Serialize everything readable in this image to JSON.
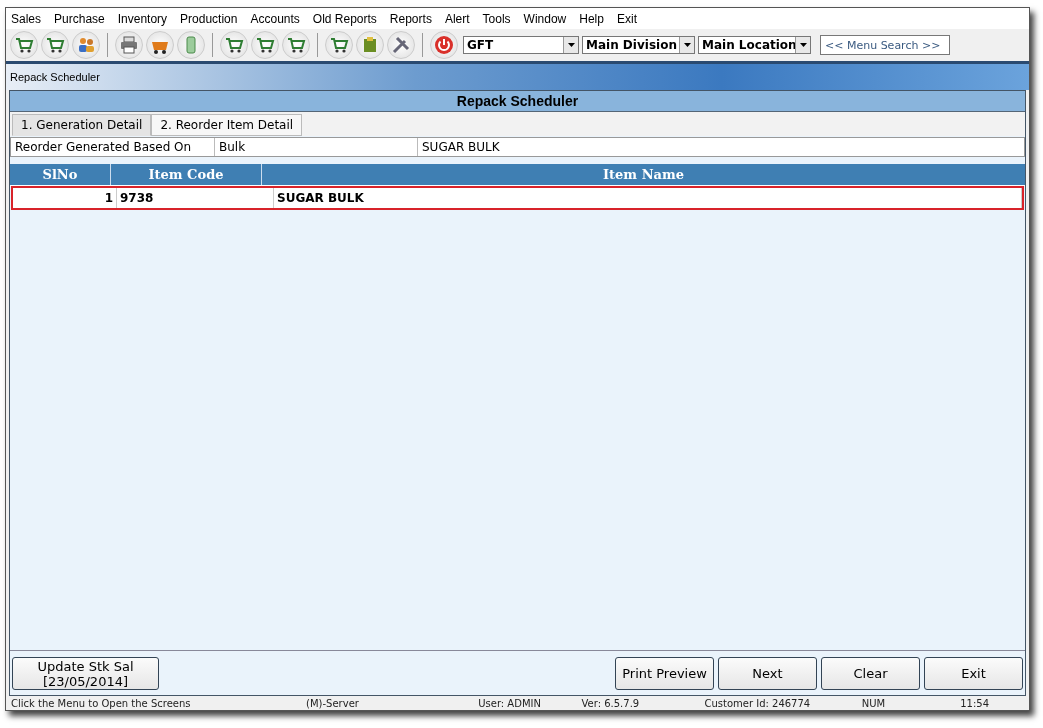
{
  "menu": [
    "Sales",
    "Purchase",
    "Inventory",
    "Production",
    "Accounts",
    "Old Reports",
    "Reports",
    "Alert",
    "Tools",
    "Window",
    "Help",
    "Exit"
  ],
  "toolbar": {
    "combos": [
      {
        "value": "GFT"
      },
      {
        "value": "Main Division"
      },
      {
        "value": "Main Location"
      }
    ],
    "search": {
      "placeholder": "<< Menu Search >>"
    }
  },
  "window": {
    "title": "Repack Scheduler"
  },
  "panel": {
    "title": "Repack Scheduler",
    "tabs": [
      {
        "label": "1. Generation Detail",
        "selected": true
      },
      {
        "label": "2. Reorder Item Detail",
        "selected": false
      }
    ],
    "basis": {
      "label": "Reorder Generated Based On",
      "value": "Bulk",
      "item": "SUGAR BULK"
    },
    "table": {
      "columns": [
        "SlNo",
        "Item Code",
        "Item Name"
      ],
      "rows": [
        {
          "cells": [
            "1",
            "9738",
            "SUGAR BULK"
          ],
          "selected": true
        }
      ]
    },
    "update_button": {
      "lines": [
        "Update Stk Sal",
        "[23/05/2014]"
      ]
    },
    "buttons": [
      "Print Preview",
      "Next",
      "Clear",
      "Exit"
    ]
  },
  "status_bar": [
    "Click the Menu to Open the Screens",
    "(M)-Server",
    "User: ADMIN",
    "Ver: 6.5.7.9",
    "Customer Id: 246774",
    "NUM",
    "11:54"
  ]
}
